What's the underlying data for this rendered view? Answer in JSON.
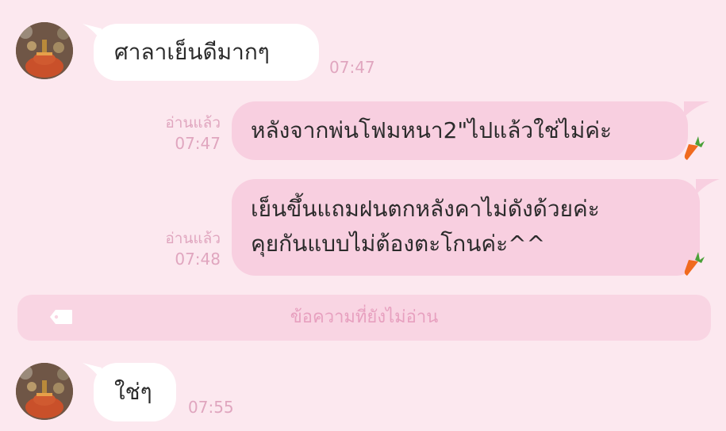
{
  "messages": [
    {
      "text": "ศาลาเย็นดีมากๆ",
      "time": "07:47"
    },
    {
      "text": "หลังจากพ่นโฟมหนา2\"ไปแล้วใช่ไม่ค่ะ",
      "read": "อ่านแล้ว",
      "time": "07:47"
    },
    {
      "line1": "เย็นขึ้นแถมฝนตกหลังคาไม่ดังด้วยค่ะ",
      "line2": "คุยกันแบบไม่ต้องตะโกนค่ะ^^",
      "read": "อ่านแล้ว",
      "time": "07:48"
    },
    {
      "text": "ใช่ๆ",
      "time": "07:55"
    }
  ],
  "unread_divider": {
    "label": "ข้อความที่ยังไม่อ่าน",
    "icon": "tag-icon"
  },
  "colors": {
    "background": "#fce8ef",
    "incoming_bubble": "#ffffff",
    "outgoing_bubble": "#f8cfe0",
    "meta_text": "#e0a6bf",
    "divider": "#f9d5e3"
  }
}
